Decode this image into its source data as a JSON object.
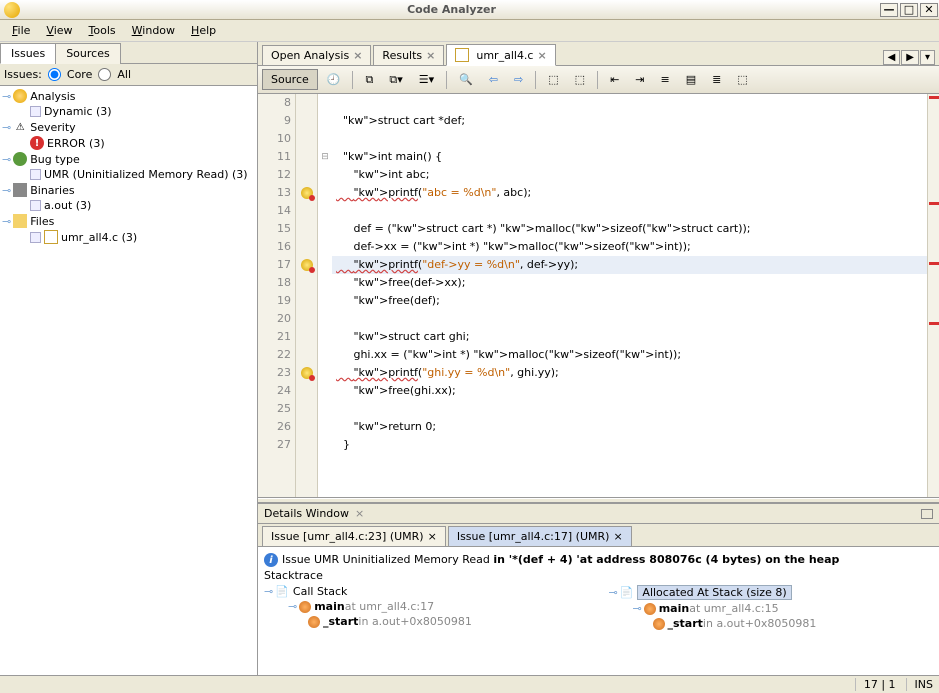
{
  "window": {
    "title": "Code Analyzer"
  },
  "menu": [
    "File",
    "View",
    "Tools",
    "Window",
    "Help"
  ],
  "left_tabs": [
    "Issues",
    "Sources"
  ],
  "filter": {
    "label": "Issues:",
    "opt1": "Core",
    "opt2": "All"
  },
  "tree": {
    "analysis": {
      "label": "Analysis",
      "child": "Dynamic (3)"
    },
    "severity": {
      "label": "Severity",
      "child": "ERROR (3)"
    },
    "bugtype": {
      "label": "Bug type",
      "child": "UMR (Uninitialized Memory Read) (3)"
    },
    "binaries": {
      "label": "Binaries",
      "child": "a.out (3)"
    },
    "files": {
      "label": "Files",
      "child": "umr_all4.c (3)"
    }
  },
  "doc_tabs": [
    {
      "label": "Open Analysis"
    },
    {
      "label": "Results"
    },
    {
      "label": "umr_all4.c",
      "active": true
    }
  ],
  "toolbar": {
    "source": "Source"
  },
  "code": {
    "start": 8,
    "lines": [
      "",
      "  struct cart *def;",
      "",
      "  int main() {",
      "     int abc;",
      "     printf(\"abc = %d\\n\", abc);",
      "",
      "     def = (struct cart *) malloc(sizeof(struct cart));",
      "     def->xx = (int *) malloc(sizeof(int));",
      "     printf(\"def->yy = %d\\n\", def->yy);",
      "     free(def->xx);",
      "     free(def);",
      "",
      "     struct cart ghi;",
      "     ghi.xx = (int *) malloc(sizeof(int));",
      "     printf(\"ghi.yy = %d\\n\", ghi.yy);",
      "     free(ghi.xx);",
      "",
      "     return 0;",
      "  }"
    ]
  },
  "details": {
    "title": "Details Window"
  },
  "issue_tabs": [
    "Issue [umr_all4.c:23] (UMR)",
    "Issue [umr_all4.c:17] (UMR)"
  ],
  "issue": {
    "prefix": "Issue UMR Uninitialized Memory Read ",
    "mid": "in '*(def + 4) 'at address 808076c (4 bytes) on the heap",
    "stack_label": "Stacktrace",
    "call": {
      "title": "Call Stack",
      "r1a": "main",
      "r1b": " at umr_all4.c:17",
      "r2a": "_start",
      "r2b": " in a.out+0x8050981"
    },
    "alloc": {
      "title": "Allocated At Stack (size 8)",
      "r1a": "main",
      "r1b": " at umr_all4.c:15",
      "r2a": "_start",
      "r2b": " in a.out+0x8050981"
    }
  },
  "status": {
    "pos": "17 | 1",
    "mode": "INS"
  }
}
